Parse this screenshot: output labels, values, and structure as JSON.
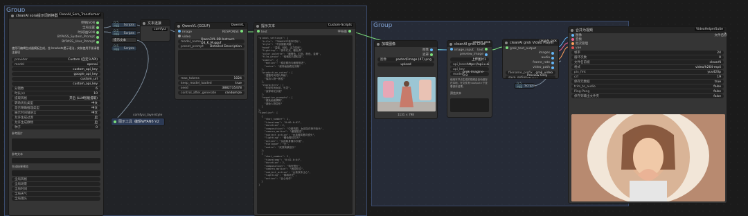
{
  "groups": {
    "left_title": "Group",
    "right_title": "Group"
  },
  "node_sora": {
    "title": "cleanAI sora提示词转换器",
    "id": "#33 5",
    "tag": "CleanAI_Sora_Transformer",
    "outputs": [
      "完整JSON",
      "全局设置",
      "时间轴JSON",
      "BYPASS_System_Prompt",
      "BYPASS_User_Prompt"
    ],
    "desc": "使用可编辑生成器模板生成，含 brackets提示语法，安装使用手册请看注意项",
    "widgets": [
      {
        "k": "provider",
        "v": "Custom (自定义API)"
      },
      {
        "k": "model",
        "v": "openai"
      },
      {
        "k": "",
        "v": "custom_api_key"
      },
      {
        "k": "",
        "v": "google_api_key"
      },
      {
        "k": "",
        "v": "custom_url"
      },
      {
        "k": "",
        "v": "custom_api_key"
      },
      {
        "k": "分镜数",
        "v": "6"
      },
      {
        "k": "时长(s)",
        "v": "10"
      },
      {
        "k": "提取风格",
        "v": "开启 (LLM智能提取)"
      },
      {
        "k": "转场优化类型",
        "v": "中文"
      },
      {
        "k": "是否精确推理类型",
        "v": "中文"
      },
      {
        "k": "展示时间轴语言",
        "v": "中文"
      },
      {
        "k": "允许生成过渡",
        "v": "启"
      },
      {
        "k": "允许生成静物",
        "v": "启"
      },
      {
        "k": "种子",
        "v": "0"
      }
    ],
    "area1_label": "参考图片",
    "area2_label": "参考文本",
    "area3_label": "生成结果预览",
    "bottom_rows": [
      "全局风格",
      "全局场景",
      "全局时间",
      "全局天气",
      "全局镜头"
    ]
  },
  "minis": [
    {
      "id": "0.5 MIB",
      "label": "提示文本",
      "name": "Scripts"
    },
    {
      "id": "0.5 MIB",
      "label": "提示文本",
      "name": "Scripts"
    },
    {
      "id": "0.5 MIB",
      "label": "提示文本",
      "name": "Scripts"
    },
    {
      "id": "0.5 MIB",
      "label": "提示文本",
      "name": "Scripts"
    }
  ],
  "node_text_concat": {
    "title": "文本连接",
    "tag": "comfyui",
    "id": "#22 5"
  },
  "node_qwen": {
    "title": "QwenVL (GGUF)",
    "tag": "QwenVL",
    "id": "#14 5",
    "inputs": [
      "image",
      "video"
    ],
    "output": "RESPONSE",
    "widgets": [
      {
        "k": "model_name",
        "v": "Qwen3VL-8B-Instruct-Q4_K_M.gguf"
      },
      {
        "k": "preset_prompt",
        "v": "Detailed Description"
      }
    ],
    "widgets2": [
      {
        "k": "max_tokens",
        "v": "1024"
      },
      {
        "k": "keep_model_loaded",
        "v": "true"
      },
      {
        "k": "seed",
        "v": "3882735478"
      },
      {
        "k": "control_after_generate",
        "v": "randomize"
      }
    ]
  },
  "node_load_style": {
    "title": "图示工具",
    "value": "编辑WFAN6 V2",
    "tag": "comfyui_layerstyle",
    "id": "#31 5"
  },
  "node_custom": {
    "title": "提示文本",
    "tag": "Custom-Scripts",
    "id": "#10 5",
    "input": "text",
    "output": "字符串",
    "code": "\"global_settings\": {\n  \"title\": \"TOWNSHIP夜市时尚\",\n  \"style\": \"写实摄影风格\",\n  \"mood\": \"温馨、轻松、活力四射\",\n  \"lighting\": \"夜市灯光、暖色调\",\n  \"color_palette\": \"暖橙色、红色、粉色、金黄\",\n  \"film_grain\": \"轻微胶片颗粒感\",\n  \"camera\": {\n    \"motion\": \"稳定跟拍与缓慢推进\",\n    \"notes\": \"保持画面稳定流畅\"\n  },\n  \"production_notes\": [\n    \"遵循时尚短片风格\",\n    \"保持人物一致性\"\n  ],\n  \"characters\": [\n    \"年轻时尚女孩，长发\",\n    \"身穿碎花长裙\"\n  ],\n  \"negative_prompts\": [\n    \"避免画面模糊\",\n    \"避免人物变形\"\n  ]\n},\n\"timeline\": [\n  {\n    \"shot_number\": 1,\n    \"timestamp\": \"0:00-0:02\",\n    \"duration\": 2,\n    \"composition\": \"中景构图，女孩站在夜市街头\",\n    \"camera_motion\": \"缓慢推进\",\n    \"subject_action\": \"女孩微笑看向镜头\",\n    \"lighting\": \"暖色霓虹灯光\",\n    \"action\": \"女孩转身展示长裙\",\n    \"dialogue\": \"无\",\n    \"audio\": \"欢快背景音乐\"\n  },\n  {\n    \"shot_number\": 2,\n    \"timestamp\": \"0:02-0:04\",\n    \"duration\": 2,\n    \"composition\": \"特写镜头\",\n    \"camera_motion\": \"固定机位\",\n    \"subject_action\": \"女孩双手比心\",\n    \"lighting\": \"柔和补光\",\n    \"action\": \"比心动作\"\n  }\n]"
  },
  "node_load_img": {
    "title": "加载图像",
    "id": "#1 5",
    "outputs": [
      "图像",
      "遮罩"
    ],
    "widgets": [
      {
        "k": "图像",
        "v": "pasted/image (47).png"
      },
      {
        "k": "",
        "v": "upload"
      }
    ],
    "img_caption": "1131 × 798"
  },
  "node_grok_chat": {
    "title": "cleanAI grok Chat",
    "tag": "cleanAI_grok",
    "id": "#8 5",
    "inputs": [
      "image_input"
    ],
    "outputs": [
      "text",
      "preview_image"
    ],
    "widgets": [
      {
        "k": "",
        "v": "上传图片1"
      },
      {
        "k": "api_base",
        "v": "https://api.x.ai"
      },
      {
        "k": "api_key",
        "v": ""
      },
      {
        "k": "model",
        "v": "grok-imagine-0.9"
      }
    ],
    "hint": "使用本节点生成的视频会自动保存在本地，在文件夹<output>下查看保存结果。",
    "area_label": "预览文本"
  },
  "node_grok_video": {
    "title": "cleanAI grok Video Player",
    "tag": "cleanAI_grok",
    "id": "#25 5",
    "inputs": [
      "grok_text_output"
    ],
    "outputs": [
      "images",
      "audio",
      "frame_rate",
      "video_path"
    ],
    "widgets": [
      {
        "k": "filename_prefix",
        "v": "grok_video"
      },
      {
        "k": "save_option",
        "v": "Preview Only (Temp)"
      }
    ]
  },
  "node_combine": {
    "title": "合并为视频",
    "tag": "VideoHelperSuite",
    "id": "#13 5",
    "inputs": [
      "图像",
      "音频",
      "批次管理",
      "vae"
    ],
    "output": "文件名",
    "widgets": [
      {
        "k": "帧率",
        "v": "24"
      },
      {
        "k": "循环次数",
        "v": "0"
      },
      {
        "k": "文件名前缀",
        "v": "cleanAI"
      },
      {
        "k": "格式",
        "v": "video/h264-mp4"
      },
      {
        "k": "pix_fmt",
        "v": "yuv420p"
      },
      {
        "k": "crf",
        "v": "19"
      },
      {
        "k": "保存元数据",
        "v": "true"
      },
      {
        "k": "trim_to_audio",
        "v": "false"
      },
      {
        "k": "Ping-Pong",
        "v": "false"
      },
      {
        "k": "保存到输出文件夹",
        "v": "false"
      }
    ]
  },
  "colors": {
    "port_image": "#64b5f6",
    "port_text": "#7ce07c",
    "port_audio": "#f06292",
    "port_latent": "#ff9f5a",
    "wire": "#7c8c9c"
  }
}
